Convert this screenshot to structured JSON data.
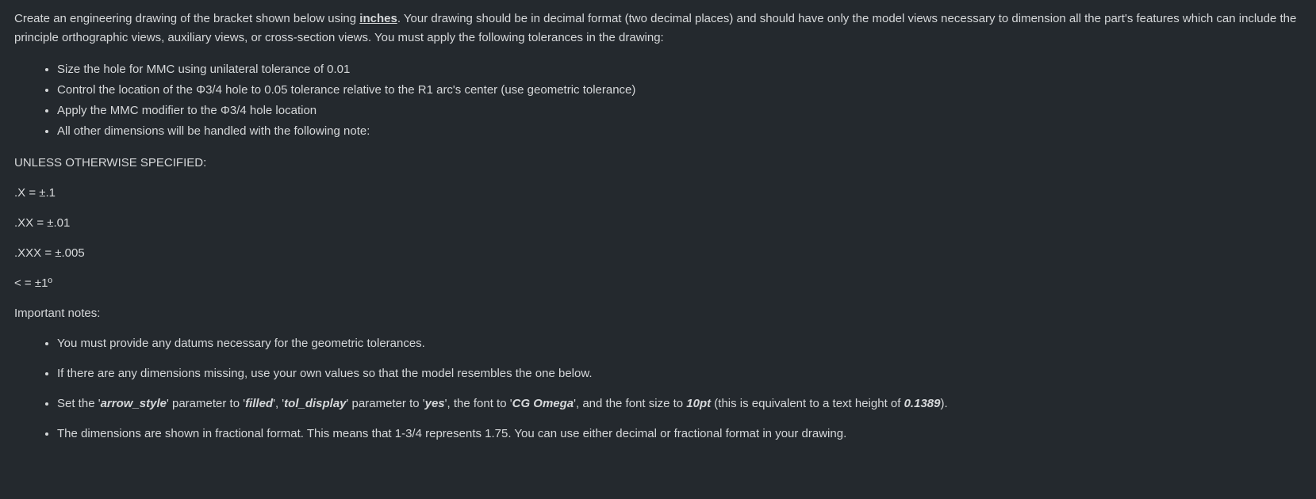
{
  "intro": {
    "part1": "Create an engineering drawing of the bracket shown below using ",
    "inches": "inches",
    "part2": ".  Your drawing should be in decimal format (two decimal places) and should have only the model views necessary to dimension all the part's features which can include the principle orthographic views, auxiliary views, or cross-section views.  You must apply the following tolerances in the drawing:"
  },
  "tolerances": [
    "Size the hole for MMC using unilateral tolerance of 0.01",
    "Control the location of the Φ3/4 hole to 0.05 tolerance relative to the R1 arc's center (use geometric tolerance)",
    "Apply the MMC modifier to the Φ3/4 hole location",
    "All other dimensions will be handled with the following note:"
  ],
  "spec": {
    "heading": "UNLESS OTHERWISE SPECIFIED:",
    "lines": [
      ".X = ±.1",
      ".XX = ±.01",
      ".XXX = ±.005",
      "< = ±1º"
    ]
  },
  "important": {
    "heading": "Important notes:",
    "items": [
      {
        "type": "plain",
        "text": "You must provide any datums necessary for the geometric tolerances."
      },
      {
        "type": "plain",
        "text": "If there are any dimensions missing, use your own values so that the model resembles the one below."
      },
      {
        "type": "params",
        "p1": "Set the '",
        "arrow_style": "arrow_style",
        "p2": "' parameter to '",
        "filled": "filled",
        "p3": "', '",
        "tol_display": "tol_display",
        "p4": "' parameter to '",
        "yes": "yes",
        "p5": "', the font to '",
        "cg_omega": "CG Omega",
        "p6": "', and the font size to ",
        "tenpt": "10pt",
        "p7": " (this is equivalent to a text height of ",
        "height": "0.1389",
        "p8": ")."
      },
      {
        "type": "plain",
        "text": "The dimensions are shown in fractional format.  This means that 1-3/4 represents 1.75.  You can use either decimal or fractional format in your drawing."
      }
    ]
  }
}
